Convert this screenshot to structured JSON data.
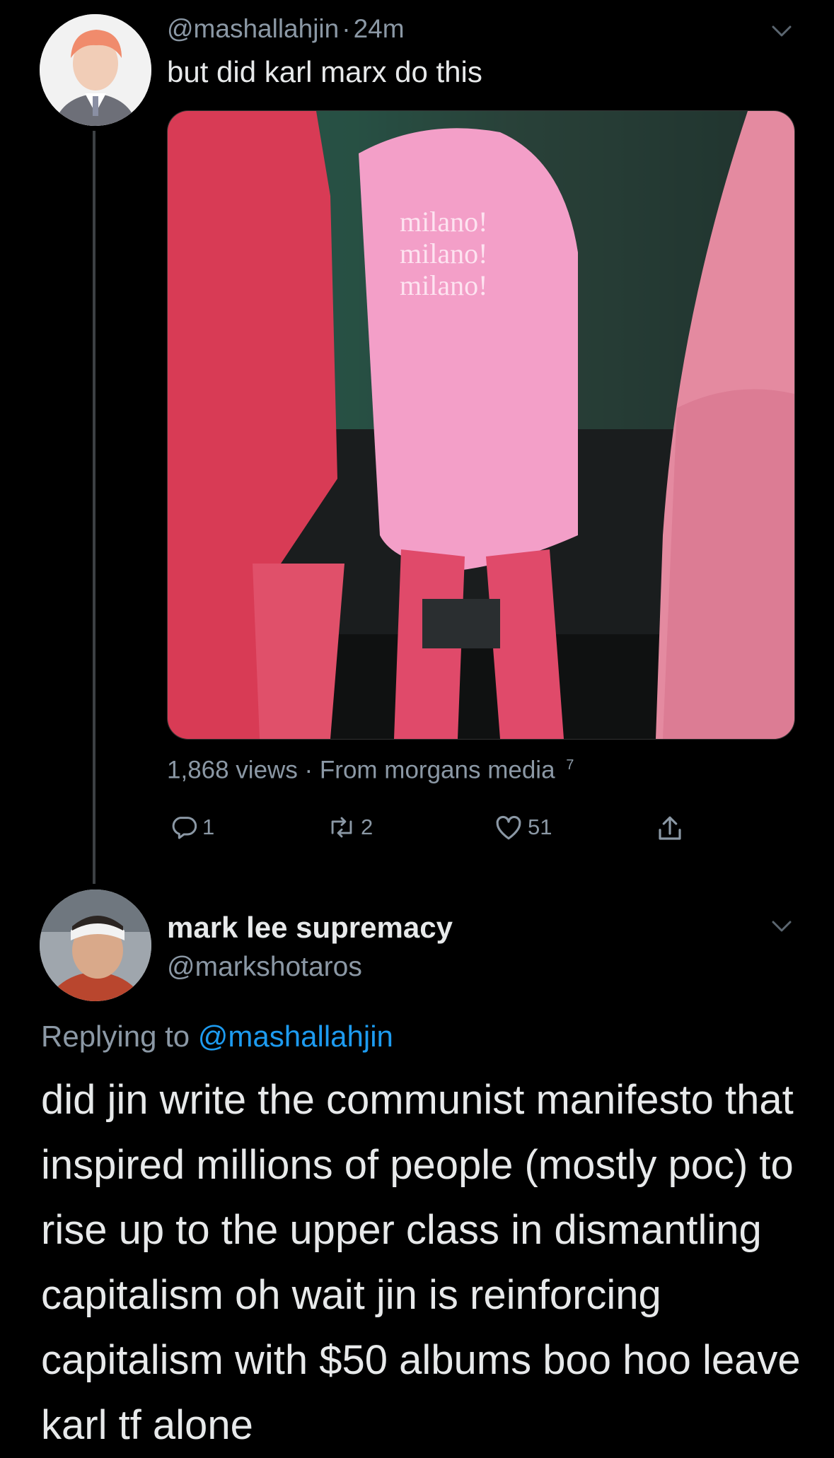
{
  "tweet1": {
    "handle": "@mashallahjin",
    "time_sep": "·",
    "time": "24m",
    "text": "but did karl marx do this",
    "media": {
      "shirt_text": [
        "milano!",
        "milano!",
        "milano!"
      ]
    },
    "views_line": "1,868 views · From morgans media",
    "views_superscript": "7",
    "actions": {
      "replies": "1",
      "retweets": "2",
      "likes": "51"
    }
  },
  "tweet2": {
    "display_name": "mark lee supremacy",
    "handle": "@markshotaros",
    "replying_prefix": "Replying to",
    "replying_handle": "@mashallahjin",
    "text": "did jin write the communist manifesto that inspired millions of people (mostly poc) to rise up to the upper class in dismantling capitalism oh wait jin is reinforcing capitalism with $50 albums boo hoo leave karl tf alone"
  },
  "colors": {
    "background": "#000000",
    "link": "#1d9bf0",
    "muted": "#8b98a5",
    "text": "#e7e9ea"
  }
}
